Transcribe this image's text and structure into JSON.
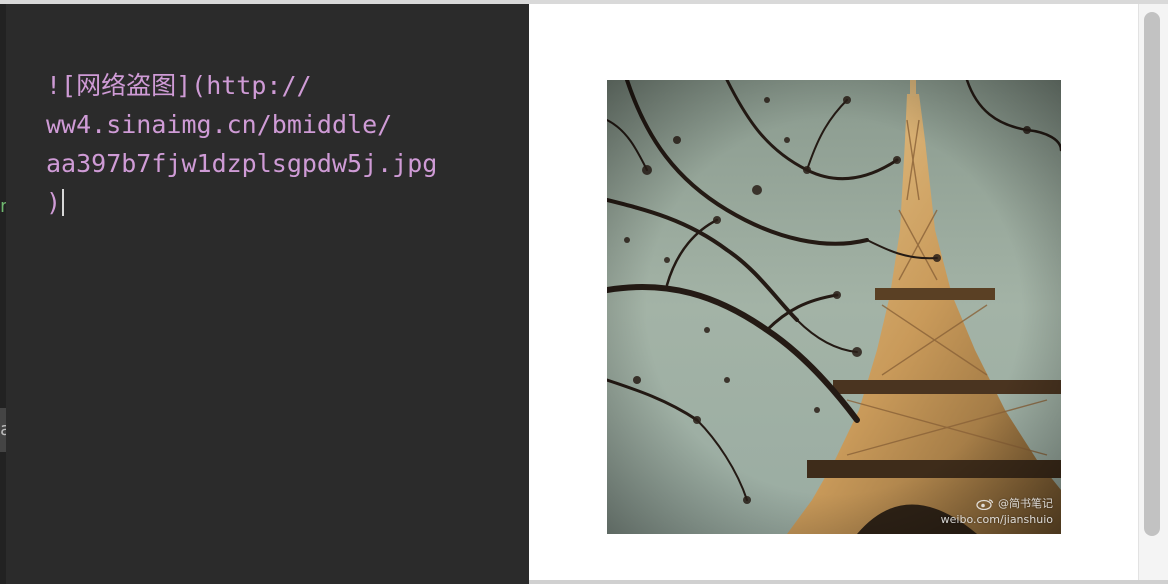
{
  "editor": {
    "lines": [
      "![网络盗图](http://",
      "ww4.sinaimg.cn/bmiddle/",
      "aa397b7fjw1dzplsgpdw5j.jpg",
      ")"
    ],
    "text_color": "#cf9bd6",
    "background": "#2b2b2b"
  },
  "gutter": {
    "mark_1": "n",
    "mark_2": "a"
  },
  "preview": {
    "image_subject": "eiffel-tower-with-tree-branches",
    "watermark_handle": "@简书笔记",
    "watermark_url": "weibo.com/jianshuio",
    "watermark_icon": "weibo-icon"
  },
  "colors": {
    "preview_background": "#ffffff",
    "scrollbar_thumb": "#c2c2c2"
  }
}
